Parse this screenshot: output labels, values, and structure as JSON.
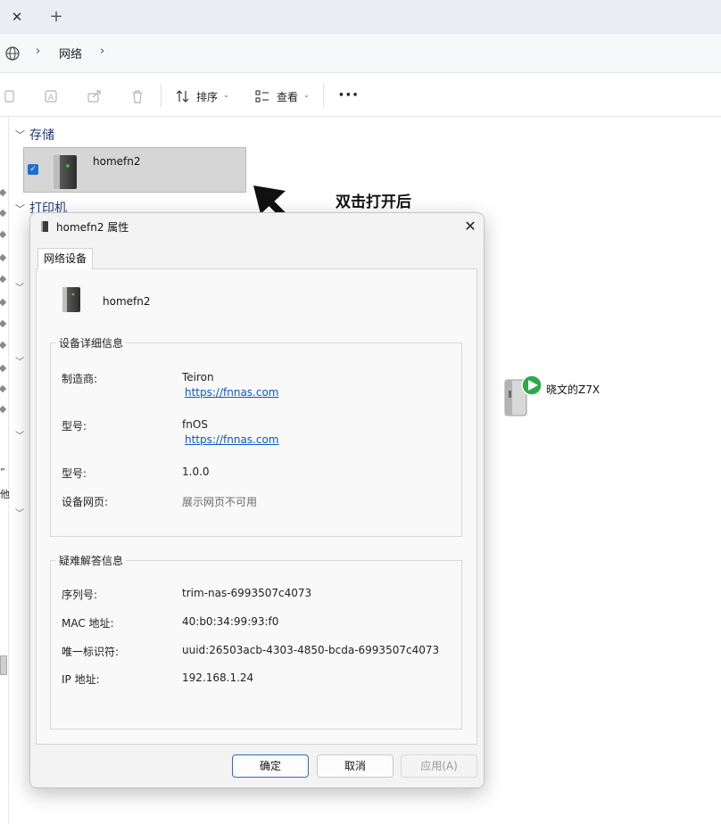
{
  "tabbar": {
    "close_glyph": "✕",
    "new_tab_glyph": "+"
  },
  "address_bar": {
    "breadcrumb": [
      "网络"
    ]
  },
  "toolbar": {
    "sort_label": "排序",
    "view_label": "查看",
    "more_label": "···"
  },
  "content": {
    "groups": [
      {
        "title": "存储"
      },
      {
        "title": "打印机"
      }
    ],
    "selected_device": {
      "name": "homefn2",
      "checked": true
    },
    "peer_device": {
      "name": "晓文的Z7X"
    },
    "annotation": "双击打开后",
    "left_fragments": [
      "”",
      "他"
    ]
  },
  "dialog": {
    "title": "homefn2 属性",
    "tab": "网络设备",
    "device_name": "homefn2",
    "details": {
      "legend": "设备详细信息",
      "manufacturer_label": "制造商:",
      "manufacturer_value": "Teiron",
      "manufacturer_url": "https://fnnas.com",
      "model_label": "型号:",
      "model_value": "fnOS",
      "model_url": "https://fnnas.com",
      "model_number_label": "型号:",
      "model_number_value": "1.0.0",
      "webpage_label": "设备网页:",
      "webpage_value": "展示网页不可用"
    },
    "troubleshooting": {
      "legend": "疑难解答信息",
      "serial_label": "序列号:",
      "serial_value": "trim-nas-6993507c4073",
      "mac_label": "MAC 地址:",
      "mac_value": "40:b0:34:99:93:f0",
      "uid_label": "唯一标识符:",
      "uid_value": "uuid:26503acb-4303-4850-bcda-6993507c4073",
      "ip_label": "IP 地址:",
      "ip_value": "192.168.1.24"
    },
    "buttons": {
      "ok": "确定",
      "cancel": "取消",
      "apply": "应用(A)"
    }
  },
  "colors": {
    "accent": "#1f6fd1",
    "link": "#0b57d0",
    "group_title": "#1f3c78"
  }
}
